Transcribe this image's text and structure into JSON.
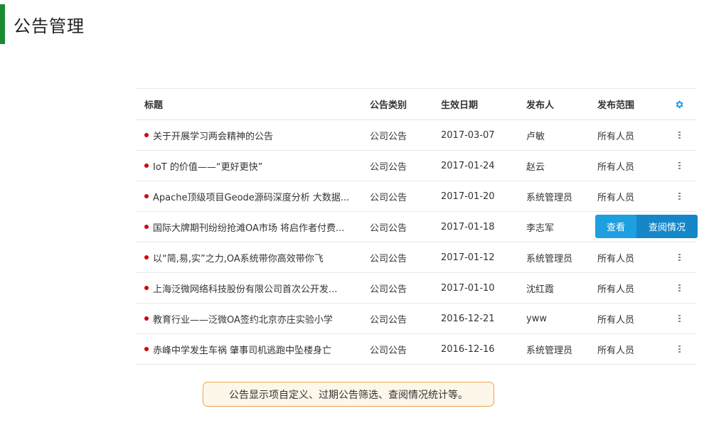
{
  "page": {
    "title": "公告管理",
    "accent_color": "#1a8a32"
  },
  "table": {
    "columns": {
      "title": "标题",
      "category": "公告类别",
      "date": "生效日期",
      "publisher": "发布人",
      "scope": "发布范围",
      "settings_icon": "gear-icon"
    },
    "rows": [
      {
        "title": "关于开展学习两会精神的公告",
        "category": "公司公告",
        "date": "2017-03-07",
        "publisher": "卢敏",
        "scope": "所有人员"
      },
      {
        "title": "IoT 的价值——“更好更快”",
        "category": "公司公告",
        "date": "2017-01-24",
        "publisher": "赵云",
        "scope": "所有人员"
      },
      {
        "title": "Apache顶级项目Geode源码深度分析 大数据...",
        "category": "公司公告",
        "date": "2017-01-20",
        "publisher": "系统管理员",
        "scope": "所有人员"
      },
      {
        "title": "国际大牌期刊纷纷抢滩OA市场 将启作者付费...",
        "category": "公司公告",
        "date": "2017-01-18",
        "publisher": "李志军",
        "scope": ""
      },
      {
        "title": "以“简,易,实”之力,OA系统带你高效带你飞",
        "category": "公司公告",
        "date": "2017-01-12",
        "publisher": "系统管理员",
        "scope": "所有人员"
      },
      {
        "title": "上海泛微网络科技股份有限公司首次公开发...",
        "category": "公司公告",
        "date": "2017-01-10",
        "publisher": "沈红霞",
        "scope": "所有人员"
      },
      {
        "title": "教育行业——泛微OA签约北京亦庄实验小学",
        "category": "公司公告",
        "date": "2016-12-21",
        "publisher": "yww",
        "scope": "所有人员"
      },
      {
        "title": "赤峰中学发生车祸 肇事司机逃跑中坠楼身亡",
        "category": "公司公告",
        "date": "2016-12-16",
        "publisher": "系统管理员",
        "scope": "所有人员"
      }
    ],
    "hover_actions": {
      "view": "查看",
      "read_stats": "查阅情况"
    }
  },
  "note": {
    "text": "公告显示项自定义、过期公告筛选、查阅情况统计等。"
  }
}
